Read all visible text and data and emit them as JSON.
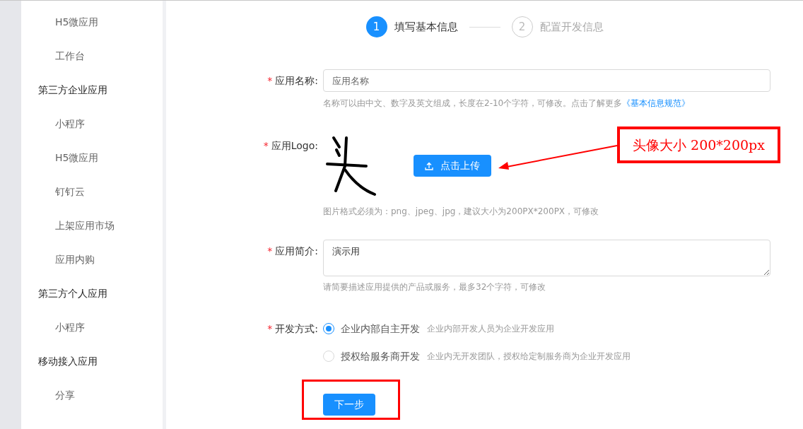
{
  "sidebar": {
    "sections": [
      {
        "items": [
          "H5微应用",
          "工作台"
        ]
      },
      {
        "title": "第三方企业应用",
        "items": [
          "小程序",
          "H5微应用",
          "钉钉云",
          "上架应用市场",
          "应用内购"
        ]
      },
      {
        "title": "第三方个人应用",
        "items": [
          "小程序"
        ]
      },
      {
        "title": "移动接入应用",
        "items": [
          "分享"
        ]
      }
    ]
  },
  "steps": [
    {
      "number": "1",
      "label": "填写基本信息",
      "selected": true
    },
    {
      "number": "2",
      "label": "配置开发信息",
      "selected": false
    }
  ],
  "form": {
    "name": {
      "label": "应用名称:",
      "required_mark": "*",
      "placeholder": "应用名称",
      "hint": "名称可以由中文、数字及英文组成，长度在2-10个字符，可修改。点击了解更多",
      "hint_link": "《基本信息规范》"
    },
    "logo": {
      "label": "应用Logo:",
      "required_mark": "*",
      "upload_button": "点击上传",
      "hint": "图片格式必须为：png、jpeg、jpg，建议大小为200PX*200PX，可修改"
    },
    "intro": {
      "label": "应用简介:",
      "required_mark": "*",
      "value": "演示用",
      "hint": "请简要描述应用提供的产品或服务，最多32个字符，可修改"
    },
    "dev_mode": {
      "label": "开发方式:",
      "required_mark": "*",
      "options": [
        {
          "label": "企业内部自主开发",
          "description": "企业内部开发人员为企业开发应用",
          "selected": true
        },
        {
          "label": "授权给服务商开发",
          "description": "企业内无开发团队，授权给定制服务商为企业开发应用",
          "selected": false
        }
      ]
    },
    "next_button": "下一步"
  },
  "annotations": {
    "callout": "头像大小 200*200px"
  }
}
